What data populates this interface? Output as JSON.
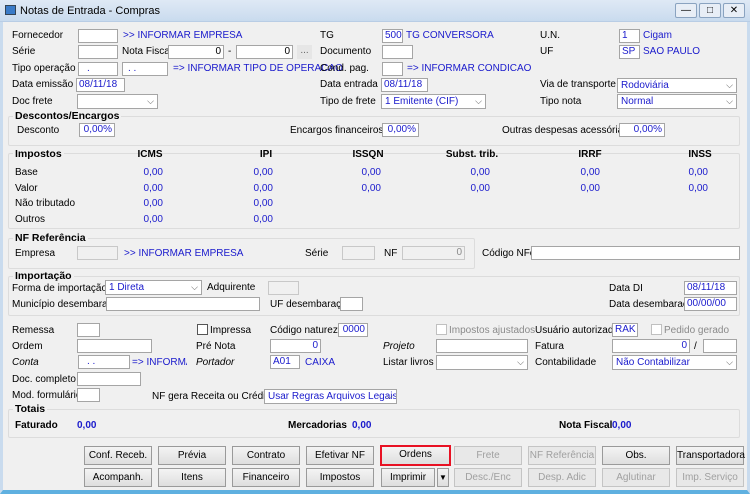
{
  "window": {
    "title": "Notas de Entrada - Compras",
    "minimize": "—",
    "maximize": "□",
    "close": "✕"
  },
  "header": {
    "fornecedor_label": "Fornecedor",
    "fornecedor_value": "",
    "fornecedor_link": ">> INFORMAR EMPRESA",
    "serie_label": "Série",
    "serie_value": "",
    "nota_fiscal_label": "Nota Fiscal",
    "nota_fiscal_from": "0",
    "dash": "-",
    "nota_fiscal_to": "0",
    "ellipsis": "...",
    "tipo_operacao_label": "Tipo operação",
    "tipo_operacao_1": ".",
    "tipo_operacao_2": ". .",
    "tipo_operacao_link": "=> INFORMAR TIPO DE OPERACAO",
    "data_emissao_label": "Data emissão",
    "data_emissao": "08/11/18",
    "doc_frete_label": "Doc frete",
    "doc_frete": "",
    "tg_label": "TG",
    "tg_value": "500",
    "tg_name": "TG CONVERSORA",
    "documento_label": "Documento",
    "documento_value": "",
    "cond_pag_label": "Cond. pag.",
    "cond_pag_value": "",
    "cond_pag_link": "=> INFORMAR CONDICAO DE PA",
    "data_entrada_label": "Data entrada",
    "data_entrada": "08/11/18",
    "tipo_frete_label": "Tipo de frete",
    "tipo_frete": "1 Emitente (CIF)",
    "un_label": "U.N.",
    "un_value": "1",
    "un_name": "Cigam",
    "uf_label": "UF",
    "uf_value": "SP",
    "uf_name": "SAO PAULO",
    "via_transporte_label": "Via de transporte",
    "via_transporte": "Rodoviária",
    "tipo_nota_label": "Tipo nota",
    "tipo_nota": "Normal"
  },
  "descontos": {
    "title": "Descontos/Encargos",
    "desconto_label": "Desconto",
    "desconto": "0,00%",
    "encargos_label": "Encargos financeiros",
    "encargos": "0,00%",
    "outras_label": "Outras despesas acessórias",
    "outras": "0,00%"
  },
  "impostos": {
    "title": "Impostos",
    "columns": [
      "ICMS",
      "IPI",
      "ISSQN",
      "Subst. trib.",
      "IRRF",
      "INSS"
    ],
    "rows": [
      {
        "label": "Base",
        "values": [
          "0,00",
          "0,00",
          "0,00",
          "0,00",
          "0,00",
          "0,00"
        ]
      },
      {
        "label": "Valor",
        "values": [
          "0,00",
          "0,00",
          "0,00",
          "0,00",
          "0,00",
          "0,00"
        ]
      },
      {
        "label": "Não tributado",
        "values": [
          "0,00",
          "0,00"
        ]
      },
      {
        "label": "Outros",
        "values": [
          "0,00",
          "0,00"
        ]
      }
    ]
  },
  "nf_referencia": {
    "title": "NF Referência",
    "empresa_label": "Empresa",
    "empresa": "",
    "empresa_link": ">> INFORMAR EMPRESA",
    "serie_label": "Série",
    "serie": "",
    "nf_label": "NF",
    "nf": "0",
    "codigo_nfe_label": "Código NFe",
    "codigo_nfe": ""
  },
  "importacao": {
    "title": "Importação",
    "forma_label": "Forma de importação",
    "forma": "1 Direta",
    "adquirente_label": "Adquirente",
    "adquirente": "",
    "data_di_label": "Data DI",
    "data_di": "08/11/18",
    "municipio_label": "Município desembaraço",
    "municipio": "",
    "uf_label": "UF desembaraço",
    "uf": "",
    "data_desembaraco_label": "Data desembaraço",
    "data_desembaraco": "00/00/00"
  },
  "misc": {
    "remessa_label": "Remessa",
    "remessa": "",
    "impressa_label": "Impressa",
    "impressa_checked": false,
    "codigo_natureza_label": "Código natureza",
    "codigo_natureza": "0000",
    "impostos_ajustados_label": "Impostos ajustados",
    "usuario_autorizado_label": "Usuário autorizado",
    "usuario_autorizado": "RAK",
    "pedido_gerado_label": "Pedido gerado",
    "ordem_label": "Ordem",
    "ordem": "",
    "pre_nota_label": "Pré Nota",
    "pre_nota": "0",
    "projeto_label": "Projeto",
    "projeto": "",
    "fatura_label": "Fatura",
    "fatura": "0",
    "fatura_sep": "/",
    "fatura_2": "",
    "conta_label": "Conta",
    "conta": ". .",
    "conta_link": "=> INFORMAI",
    "portador_label": "Portador",
    "portador": "A01",
    "portador_name": "CAIXA",
    "listar_livros_label": "Listar livros",
    "listar_livros": "",
    "contabilidade_label": "Contabilidade",
    "contabilidade": "Não Contabilizar",
    "doc_completo_label": "Doc. completo",
    "doc_completo": "",
    "mod_formulario_label": "Mod. formulário",
    "mod_formulario": "",
    "nf_gera_label": "NF gera Receita ou Crédito",
    "nf_gera": "Usar Regras Arquivos Legais"
  },
  "totais": {
    "title": "Totais",
    "faturado_label": "Faturado",
    "faturado": "0,00",
    "mercadorias_label": "Mercadorias",
    "mercadorias": "0,00",
    "nota_fiscal_label": "Nota Fiscal",
    "nota_fiscal": "0,00"
  },
  "buttons": {
    "row1": [
      "Conf. Receb.",
      "Prévia",
      "Contrato",
      "Efetivar NF",
      "Ordens",
      "Frete",
      "NF Referência",
      "Obs.",
      "Transportadora"
    ],
    "row2": [
      "Acompanh.",
      "Itens",
      "Financeiro",
      "Impostos",
      "Imprimir",
      "Desc./Enc",
      "Desp. Adic",
      "Aglutinar",
      "Imp. Serviço"
    ],
    "highlight_color": "#e81123"
  }
}
